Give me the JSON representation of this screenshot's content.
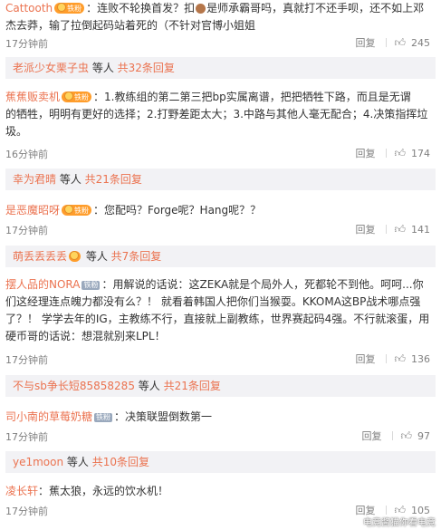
{
  "c1": {
    "line1_user": "Cattooth",
    "badge_text": "铁粉",
    "line1_text_a": "：连败不轮换首发？扣",
    "line1_text_b": "是师承霸哥吗，真就打不还手呗，还不如上邓",
    "line2": "杰去莽，输了拉倒起码站着死的（不针对官博小姐姐",
    "time": "17分钟前",
    "reply": "回复",
    "likes": "245"
  },
  "sub1": {
    "user": "老派少女栗子虫",
    "mid": " 等人 ",
    "count": "共32条回复"
  },
  "c2": {
    "user": "蕉蕉贩卖机",
    "badge_text": "铁粉",
    "line1": "：1.教练组的第二第三把bp实属离谱，把把牺牲下路，而且是无谓",
    "line2": "的牺牲，明明有更好的选择；2.打野差距太大；3.中路与其他人毫无配合；4.决策指挥垃",
    "line3": "圾。",
    "time": "16分钟前",
    "reply": "回复",
    "likes": "174"
  },
  "sub2": {
    "user": "幸为君晴",
    "mid": " 等人 ",
    "count": "共21条回复"
  },
  "c3": {
    "user": "是恶魔昭呀",
    "badge_text": "铁粉",
    "line1": "：您配吗？Forge呢？Hang呢？？",
    "time": "17分钟前",
    "reply": "回复",
    "likes": "141"
  },
  "sub3": {
    "user": "萌丢丢丢丢",
    "mid": " 等人 ",
    "count": "共7条回复"
  },
  "c4": {
    "user": "摆人品的NORA",
    "badge_text": "铁粉",
    "line1": "：用解说的话说：这ZEKA就是个局外人，死都轮不到他。呵呵...你",
    "line2": "们这经理连点魄力都没有么？！ 就看着韩国人把你们当猴耍。KKOMA这BP战术哪点强",
    "line3": "了？！ 学学去年的IG，主教练不行，直接就上副教练，世界赛起码4强。不行就滚蛋，用",
    "line4": "硬币哥的话说：想混就别来LPL！",
    "time": "17分钟前",
    "reply": "回复",
    "likes": "136"
  },
  "sub4": {
    "user": "不与sb争长短85858285",
    "mid": " 等人 ",
    "count": "共21条回复"
  },
  "c5": {
    "user": "司小南的草莓奶糖",
    "badge_text": "铁粉",
    "line1": "：决策联盟倒数第一",
    "time": "17分钟前",
    "reply": "回复",
    "likes": "97"
  },
  "sub5": {
    "user": "ye1moon",
    "mid": " 等人 ",
    "count": "共10条回复"
  },
  "c6": {
    "user": "凌长轩",
    "line1": "：蕉太狼，永远的饮水机！",
    "time": "17分钟前",
    "reply": "回复",
    "likes": "105"
  },
  "watermark": "电竞酱猫你看电竞",
  "colors": {
    "accent": "#eb7350",
    "meta": "#808080",
    "sub_bg": "#f2f2f5"
  },
  "icons": {
    "like": "thumbs-up-icon",
    "fan_badge": "fan-badge-icon"
  }
}
